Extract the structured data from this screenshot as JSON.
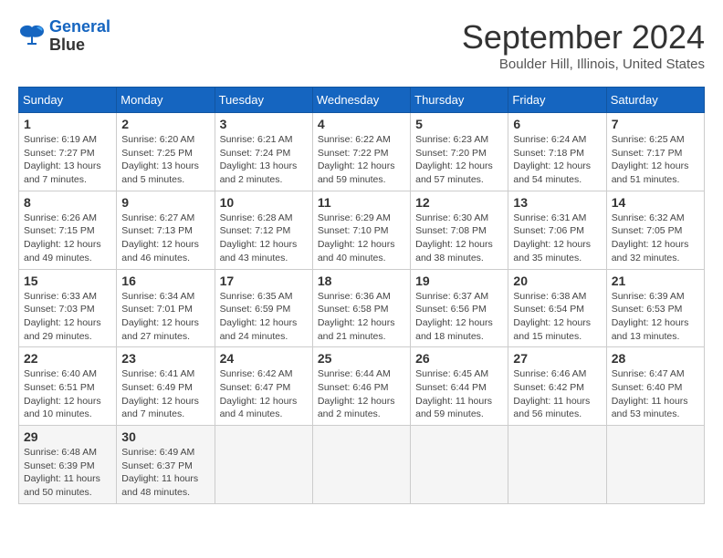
{
  "logo": {
    "line1": "General",
    "line2": "Blue"
  },
  "title": "September 2024",
  "location": "Boulder Hill, Illinois, United States",
  "days_of_week": [
    "Sunday",
    "Monday",
    "Tuesday",
    "Wednesday",
    "Thursday",
    "Friday",
    "Saturday"
  ],
  "weeks": [
    [
      {
        "day": "1",
        "sunrise": "6:19 AM",
        "sunset": "7:27 PM",
        "daylight": "13 hours and 7 minutes."
      },
      {
        "day": "2",
        "sunrise": "6:20 AM",
        "sunset": "7:25 PM",
        "daylight": "13 hours and 5 minutes."
      },
      {
        "day": "3",
        "sunrise": "6:21 AM",
        "sunset": "7:24 PM",
        "daylight": "13 hours and 2 minutes."
      },
      {
        "day": "4",
        "sunrise": "6:22 AM",
        "sunset": "7:22 PM",
        "daylight": "12 hours and 59 minutes."
      },
      {
        "day": "5",
        "sunrise": "6:23 AM",
        "sunset": "7:20 PM",
        "daylight": "12 hours and 57 minutes."
      },
      {
        "day": "6",
        "sunrise": "6:24 AM",
        "sunset": "7:18 PM",
        "daylight": "12 hours and 54 minutes."
      },
      {
        "day": "7",
        "sunrise": "6:25 AM",
        "sunset": "7:17 PM",
        "daylight": "12 hours and 51 minutes."
      }
    ],
    [
      {
        "day": "8",
        "sunrise": "6:26 AM",
        "sunset": "7:15 PM",
        "daylight": "12 hours and 49 minutes."
      },
      {
        "day": "9",
        "sunrise": "6:27 AM",
        "sunset": "7:13 PM",
        "daylight": "12 hours and 46 minutes."
      },
      {
        "day": "10",
        "sunrise": "6:28 AM",
        "sunset": "7:12 PM",
        "daylight": "12 hours and 43 minutes."
      },
      {
        "day": "11",
        "sunrise": "6:29 AM",
        "sunset": "7:10 PM",
        "daylight": "12 hours and 40 minutes."
      },
      {
        "day": "12",
        "sunrise": "6:30 AM",
        "sunset": "7:08 PM",
        "daylight": "12 hours and 38 minutes."
      },
      {
        "day": "13",
        "sunrise": "6:31 AM",
        "sunset": "7:06 PM",
        "daylight": "12 hours and 35 minutes."
      },
      {
        "day": "14",
        "sunrise": "6:32 AM",
        "sunset": "7:05 PM",
        "daylight": "12 hours and 32 minutes."
      }
    ],
    [
      {
        "day": "15",
        "sunrise": "6:33 AM",
        "sunset": "7:03 PM",
        "daylight": "12 hours and 29 minutes."
      },
      {
        "day": "16",
        "sunrise": "6:34 AM",
        "sunset": "7:01 PM",
        "daylight": "12 hours and 27 minutes."
      },
      {
        "day": "17",
        "sunrise": "6:35 AM",
        "sunset": "6:59 PM",
        "daylight": "12 hours and 24 minutes."
      },
      {
        "day": "18",
        "sunrise": "6:36 AM",
        "sunset": "6:58 PM",
        "daylight": "12 hours and 21 minutes."
      },
      {
        "day": "19",
        "sunrise": "6:37 AM",
        "sunset": "6:56 PM",
        "daylight": "12 hours and 18 minutes."
      },
      {
        "day": "20",
        "sunrise": "6:38 AM",
        "sunset": "6:54 PM",
        "daylight": "12 hours and 15 minutes."
      },
      {
        "day": "21",
        "sunrise": "6:39 AM",
        "sunset": "6:53 PM",
        "daylight": "12 hours and 13 minutes."
      }
    ],
    [
      {
        "day": "22",
        "sunrise": "6:40 AM",
        "sunset": "6:51 PM",
        "daylight": "12 hours and 10 minutes."
      },
      {
        "day": "23",
        "sunrise": "6:41 AM",
        "sunset": "6:49 PM",
        "daylight": "12 hours and 7 minutes."
      },
      {
        "day": "24",
        "sunrise": "6:42 AM",
        "sunset": "6:47 PM",
        "daylight": "12 hours and 4 minutes."
      },
      {
        "day": "25",
        "sunrise": "6:44 AM",
        "sunset": "6:46 PM",
        "daylight": "12 hours and 2 minutes."
      },
      {
        "day": "26",
        "sunrise": "6:45 AM",
        "sunset": "6:44 PM",
        "daylight": "11 hours and 59 minutes."
      },
      {
        "day": "27",
        "sunrise": "6:46 AM",
        "sunset": "6:42 PM",
        "daylight": "11 hours and 56 minutes."
      },
      {
        "day": "28",
        "sunrise": "6:47 AM",
        "sunset": "6:40 PM",
        "daylight": "11 hours and 53 minutes."
      }
    ],
    [
      {
        "day": "29",
        "sunrise": "6:48 AM",
        "sunset": "6:39 PM",
        "daylight": "11 hours and 50 minutes."
      },
      {
        "day": "30",
        "sunrise": "6:49 AM",
        "sunset": "6:37 PM",
        "daylight": "11 hours and 48 minutes."
      },
      null,
      null,
      null,
      null,
      null
    ]
  ],
  "labels": {
    "sunrise": "Sunrise:",
    "sunset": "Sunset:",
    "daylight": "Daylight:"
  }
}
